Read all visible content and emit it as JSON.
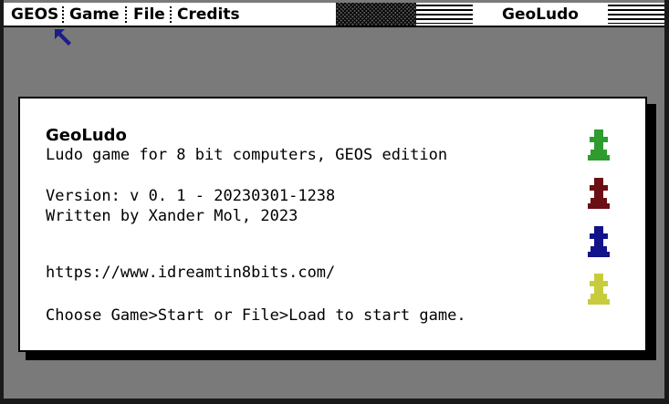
{
  "menu": {
    "items": [
      "GEOS",
      "Game",
      "File",
      "Credits"
    ],
    "app_title": "GeoLudo"
  },
  "dialog": {
    "title": "GeoLudo",
    "subtitle": "Ludo game for 8 bit computers, GEOS edition",
    "version": "Version: v 0. 1 - 20230301-1238",
    "author": "Written by Xander Mol, 2023",
    "url": "https://www.idreamtin8bits.com/",
    "instructions": "Choose Game>Start or File>Load to start game."
  },
  "pawns": [
    {
      "name": "green-pawn-icon",
      "color": "#2e9c2e"
    },
    {
      "name": "red-pawn-icon",
      "color": "#6b0f14"
    },
    {
      "name": "blue-pawn-icon",
      "color": "#12138a"
    },
    {
      "name": "yellow-pawn-icon",
      "color": "#c8cc3c"
    }
  ],
  "colors": {
    "desktop": "#7a7a7a",
    "pointer": "#1c1c8a"
  }
}
